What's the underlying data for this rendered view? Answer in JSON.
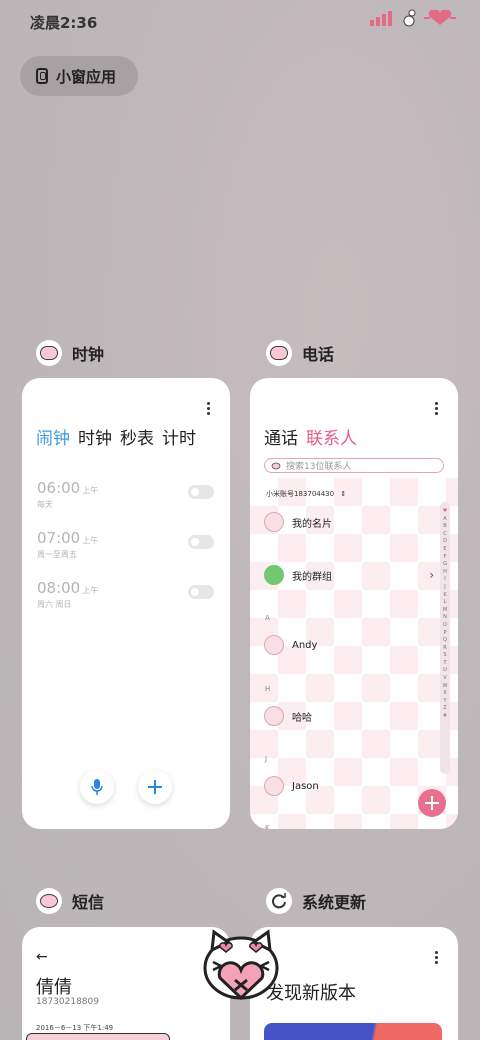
{
  "status": {
    "time": "凌晨2:36"
  },
  "float_window": {
    "label": "小窗应用"
  },
  "clock": {
    "app_name": "时钟",
    "tabs": [
      "闹钟",
      "时钟",
      "秒表",
      "计时"
    ],
    "alarms": [
      {
        "time": "06:00",
        "ampm": "上午",
        "days": "每天"
      },
      {
        "time": "07:00",
        "ampm": "上午",
        "days": "周一至周五"
      },
      {
        "time": "08:00",
        "ampm": "上午",
        "days": "周六 周日"
      }
    ]
  },
  "phone": {
    "app_name": "电话",
    "tabs": [
      "通话",
      "联系人"
    ],
    "search_placeholder": "搜索13位联系人",
    "account": "小米账号183704430",
    "my_card": "我的名片",
    "my_group": "我的群组",
    "sections": [
      "A",
      "H",
      "J",
      "K"
    ],
    "contacts": [
      "Andy",
      "哈哈",
      "Jason"
    ],
    "alphabet": [
      "♥",
      "A",
      "B",
      "C",
      "D",
      "E",
      "F",
      "G",
      "H",
      "I",
      "J",
      "K",
      "L",
      "M",
      "N",
      "O",
      "P",
      "Q",
      "R",
      "S",
      "T",
      "U",
      "V",
      "W",
      "X",
      "Y",
      "Z",
      "#"
    ]
  },
  "messages": {
    "app_name": "短信",
    "back": "←",
    "contact_name": "倩倩",
    "contact_number": "18730218809",
    "date": "2016－6－13 下午1:49"
  },
  "update": {
    "app_name": "系统更新",
    "title": "发现新版本"
  },
  "colors": {
    "accent_blue": "#3f9be6",
    "accent_pink": "#e85d86"
  }
}
